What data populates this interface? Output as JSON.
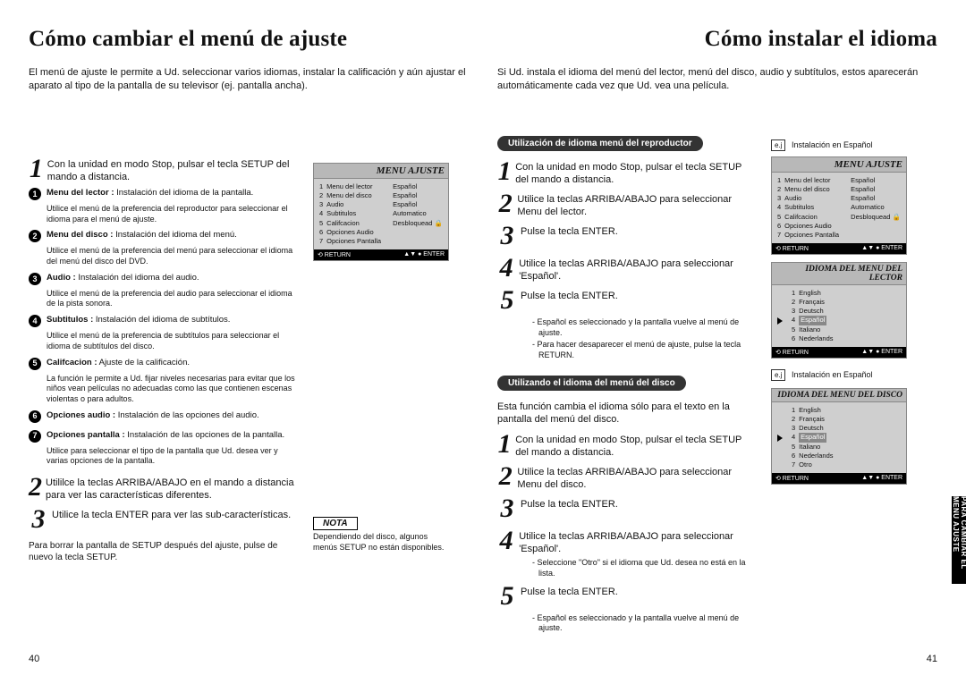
{
  "left": {
    "title": "Cómo cambiar el menú de ajuste",
    "intro": "El menú de ajuste le permite a Ud. seleccionar varios idiomas, instalar la calificación y aún ajustar el aparato al tipo de la pantalla de su televisor (ej. pantalla ancha).",
    "step1": "Con la unidad en modo Stop, pulsar el tecla SETUP del mando a distancia.",
    "bullets": [
      {
        "t": "Menu del lector :",
        "d": "Instalación del idioma de la pantalla.",
        "s": "Utilice el menú de la preferencia del reproductor para seleccionar el idioma para el menú de ajuste."
      },
      {
        "t": "Menu del disco :",
        "d": "Instalación del idioma del menú.",
        "s": "Utilice el menú de la preferencia del menú para seleccionar el idioma del menú del disco del DVD."
      },
      {
        "t": "Audio :",
        "d": "Instalación del idioma del audio.",
        "s": "Utilice el menú de la preferencia del audio para seleccionar el idioma de la pista sonora."
      },
      {
        "t": "Subtitulos :",
        "d": "Instalación del idioma de subtítulos.",
        "s": "Utilice el menú de la preferencia de subtítulos para seleccionar el idioma de subtítulos del disco."
      },
      {
        "t": "Califcacion :",
        "d": "Ajuste de la calificación.",
        "s": "La función le permite a Ud. fijar niveles necesarias para evitar que los niños vean películas no adecuadas como las que contienen escenas violentas o para adultos."
      },
      {
        "t": "Opciones audio :",
        "d": "Instalación de las opciones del audio.",
        "s": ""
      },
      {
        "t": "Opciones pantalla :",
        "d": "Instalación de las opciones de la pantalla.",
        "s": "Utilice para seleccionar el tipo de la pantalla que Ud. desea ver y varias opciones de la pantalla."
      }
    ],
    "step2": "Utililce la teclas ARRIBA/ABAJO en el mando a distancia para ver las características diferentes.",
    "step3": "Utilice la tecla ENTER para ver las sub-características.",
    "erase": "Para borrar la pantalla de SETUP después del ajuste, pulse de nuevo la tecla SETUP.",
    "nota": "NOTA",
    "notaTxt": "Dependiendo del disco, algunos menús SETUP no están disponibles.",
    "pageNo": "40"
  },
  "right": {
    "title": "Cómo instalar el idioma",
    "intro": "Si Ud. instala el idioma del menú del lector, menú del disco, audio y subtítulos, estos aparecerán automáticamente cada vez que Ud. vea una película.",
    "pill1": "Utilización de idioma menú del reproductor",
    "pill2": "Utilizando el idioma del menú del disco",
    "stepsA": [
      "Con la unidad en modo Stop, pulsar el tecla SETUP del mando a distancia.",
      "Utilice la teclas ARRIBA/ABAJO para seleccionar Menu del lector.",
      "Pulse la tecla ENTER.",
      "Utilice la teclas ARRIBA/ABAJO para seleccionar 'Español'.",
      "Pulse la tecla ENTER."
    ],
    "notesA": [
      "- Español es seleccionado y la pantalla vuelve al menú de ajuste.",
      "- Para hacer desaparecer el menú de ajuste, pulse la tecla RETURN."
    ],
    "introB": "Esta función cambia el idioma sólo para el texto en la pantalla del menú del disco.",
    "stepsB": [
      "Con la unidad en modo Stop, pulsar el tecla SETUP del mando a distancia.",
      "Utilice la teclas ARRIBA/ABAJO para seleccionar Menu del disco.",
      "Pulse la tecla ENTER.",
      "Utilice la teclas ARRIBA/ABAJO para seleccionar 'Español'."
    ],
    "notesB": [
      "- Seleccione \"Otro\" si el idioma que Ud. desea no está en la lista."
    ],
    "stepB5": "Pulse la tecla ENTER.",
    "notesB2": [
      "- Español es seleccionado y la pantalla vuelve al menú de ajuste."
    ],
    "ej": "e.j",
    "ejTxt": "Instalación en Español",
    "tab": "PARA CAMBIAR EL\nMENU AJUSTE",
    "pageNo": "41"
  },
  "panels": {
    "menuAjuste": {
      "hdr": "MENU AJUSTE",
      "rows": [
        [
          "1",
          "Menu del lector",
          "Español"
        ],
        [
          "2",
          "Menu del disco",
          "Español"
        ],
        [
          "3",
          "Audio",
          "Español"
        ],
        [
          "4",
          "Subtitulos",
          "Automatico"
        ],
        [
          "5",
          "Califcacion",
          "Desbloquead 🔒"
        ],
        [
          "6",
          "Opciones Audio",
          ""
        ],
        [
          "7",
          "Opciones Pantalla",
          ""
        ]
      ],
      "ret": "RETURN",
      "ent": "ENTER"
    },
    "lector": {
      "hdr": "IDIOMA DEL MENU DEL LECTOR",
      "rows": [
        [
          "1",
          "English"
        ],
        [
          "2",
          "Français"
        ],
        [
          "3",
          "Deutsch"
        ],
        [
          "4",
          "Español"
        ],
        [
          "5",
          "Italiano"
        ],
        [
          "6",
          "Nederlands"
        ]
      ],
      "sel": 3,
      "ret": "RETURN",
      "ent": "ENTER"
    },
    "disco": {
      "hdr": "IDIOMA DEL MENU DEL DISCO",
      "rows": [
        [
          "1",
          "English"
        ],
        [
          "2",
          "Français"
        ],
        [
          "3",
          "Deutsch"
        ],
        [
          "4",
          "Español"
        ],
        [
          "5",
          "Italiano"
        ],
        [
          "6",
          "Nederlands"
        ],
        [
          "7",
          "Otro"
        ]
      ],
      "sel": 3,
      "ret": "RETURN",
      "ent": "ENTER"
    }
  }
}
